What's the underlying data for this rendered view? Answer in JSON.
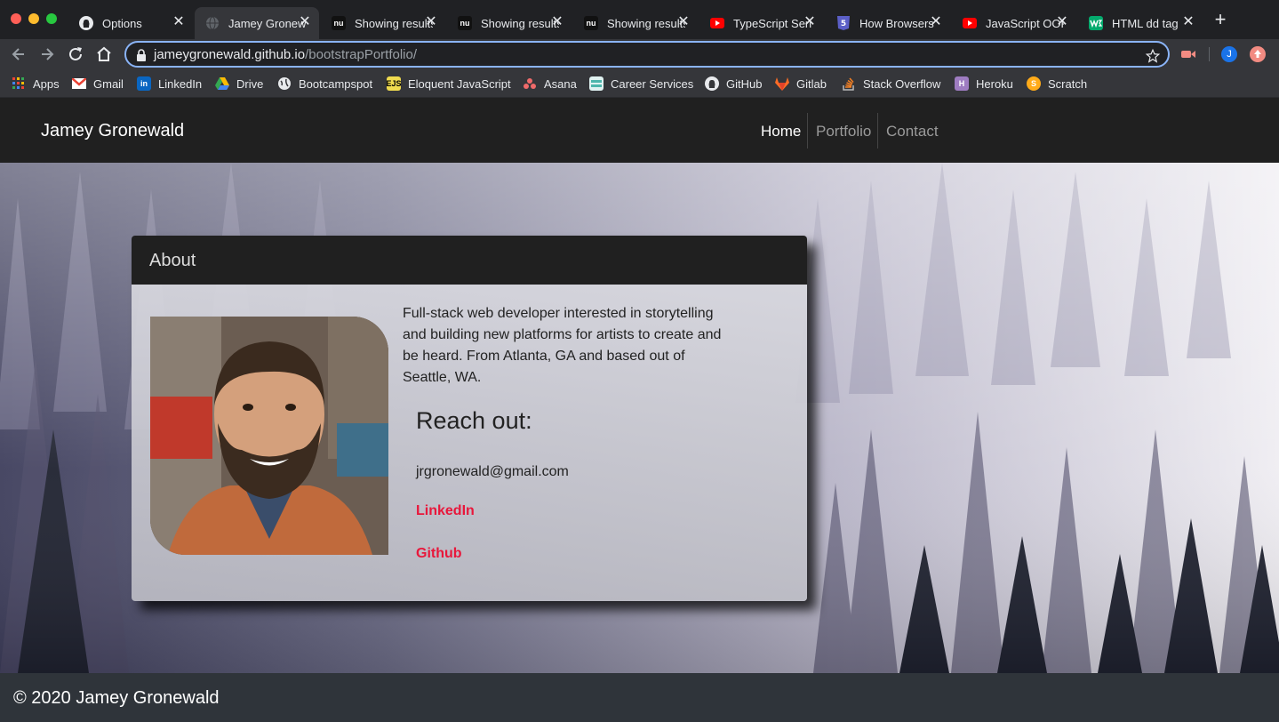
{
  "browser": {
    "tabs": [
      {
        "title": "Options",
        "icon": "github-icon"
      },
      {
        "title": "Jamey Gronewald",
        "icon": "globe-icon",
        "active": true
      },
      {
        "title": "Showing results",
        "icon": "nu-icon"
      },
      {
        "title": "Showing results",
        "icon": "nu-icon"
      },
      {
        "title": "Showing results",
        "icon": "nu-icon"
      },
      {
        "title": "TypeScript Series",
        "icon": "youtube-icon"
      },
      {
        "title": "How Browsers Work",
        "icon": "html5-icon"
      },
      {
        "title": "JavaScript OOP",
        "icon": "youtube-icon"
      },
      {
        "title": "HTML dd tag",
        "icon": "w3-icon"
      }
    ],
    "close_glyph": "✕",
    "new_tab_glyph": "+",
    "nu_glyph": "nu",
    "address": {
      "host": "jameygronewald.github.io",
      "path": "/bootstrapPortfolio/"
    },
    "profile_initial": "J",
    "bookmarks": [
      {
        "label": "Apps",
        "icon": "apps-icon",
        "color": "#e8eaed"
      },
      {
        "label": "Gmail",
        "icon": "gmail-icon",
        "color": "#ea4335"
      },
      {
        "label": "LinkedIn",
        "icon": "linkedin-icon",
        "color": "#0a66c2"
      },
      {
        "label": "Drive",
        "icon": "drive-icon",
        "color": "#34a853"
      },
      {
        "label": "Bootcampspot",
        "icon": "globe-icon",
        "color": "#e8eaed"
      },
      {
        "label": "Eloquent JavaScript",
        "icon": "ejs-icon",
        "color": "#f0db4f"
      },
      {
        "label": "Asana",
        "icon": "asana-icon",
        "color": "#f06a6a"
      },
      {
        "label": "Career Services",
        "icon": "career-icon",
        "color": "#4db6ac"
      },
      {
        "label": "GitHub",
        "icon": "github-icon",
        "color": "#e8eaed"
      },
      {
        "label": "Gitlab",
        "icon": "gitlab-icon",
        "color": "#fc6d26"
      },
      {
        "label": "Stack Overflow",
        "icon": "stackoverflow-icon",
        "color": "#f48024"
      },
      {
        "label": "Heroku",
        "icon": "heroku-icon",
        "color": "#9e7cc1"
      },
      {
        "label": "Scratch",
        "icon": "scratch-icon",
        "color": "#ffab19"
      }
    ]
  },
  "site": {
    "brand": "Jamey Gronewald",
    "nav": [
      "Home",
      "Portfolio",
      "Contact"
    ],
    "about": {
      "title": "About",
      "bio": "Full-stack web developer interested in storytelling and building new platforms for artists to create and be heard. From Atlanta, GA and based out of Seattle, WA.",
      "reach_heading": "Reach out:",
      "email": "jrgronewald@gmail.com",
      "links": [
        "LinkedIn",
        "Github"
      ]
    },
    "footer": "© 2020 Jamey Gronewald",
    "colors": {
      "accent_link": "#e8173b",
      "nav_bg": "#202020",
      "footer_bg": "#2f343a"
    }
  }
}
